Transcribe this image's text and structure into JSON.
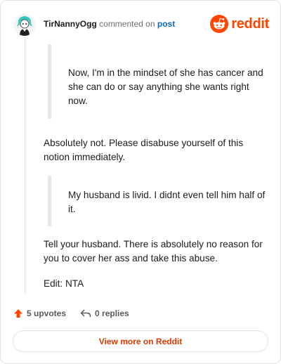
{
  "header": {
    "username": "TirNannyOgg",
    "verb": "commented on",
    "post_link": "post",
    "brand": "reddit",
    "avatar_icon": "avatar-teal-hair-icon",
    "logo_icon": "reddit-snoo-icon"
  },
  "comment": {
    "quote1": "Now, I'm in the mindset of she has cancer and she can do or say anything she wants right now.",
    "para1": "Absolutely not. Please disabuse yourself of this notion immediately.",
    "quote2": "My husband is livid. I didnt even tell him half of it.",
    "para2": "Tell your husband. There is absolutely no reason for you to cover her ass and take this abuse.",
    "para3": "Edit: NTA"
  },
  "actions": {
    "upvotes": "5 upvotes",
    "replies": "0 replies",
    "upvote_icon": "upvote-arrow-icon",
    "reply_icon": "reply-arrow-icon"
  },
  "footer": {
    "view_more": "View more on Reddit"
  },
  "colors": {
    "brand": "#ff4500",
    "link": "#0a66c2",
    "cta": "#d93a00",
    "quote_bar": "#e6e7e8"
  }
}
